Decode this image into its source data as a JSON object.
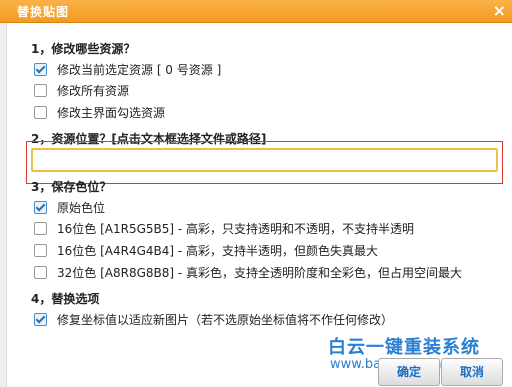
{
  "dialog": {
    "title": "替换贴图",
    "close_glyph": "×"
  },
  "section1": {
    "title": "1，修改哪些资源？",
    "options": [
      {
        "label": "修改当前选定资源 [ 0 号资源 ]",
        "checked": true
      },
      {
        "label": "修改所有资源",
        "checked": false
      },
      {
        "label": "修改主界面勾选资源",
        "checked": false
      }
    ]
  },
  "section2": {
    "title": "2，资源位置？[点击文本框选择文件或路径]",
    "path_value": ""
  },
  "section3": {
    "title": "3，保存色位？",
    "options": [
      {
        "label": "原始色位",
        "checked": true
      },
      {
        "label": "16位色 [A1R5G5B5] - 高彩，只支持透明和不透明，不支持半透明",
        "checked": false
      },
      {
        "label": "16位色 [A4R4G4B4] - 高彩，支持半透明，但颜色失真最大",
        "checked": false
      },
      {
        "label": "32位色 [A8R8G8B8] - 真彩色，支持全透明阶度和全彩色，但占用空间最大",
        "checked": false
      }
    ]
  },
  "section4": {
    "title": "4，替换选项",
    "options": [
      {
        "label": "修复坐标值以适应新图片（若不选原始坐标值将不作任何修改）",
        "checked": true
      }
    ]
  },
  "buttons": {
    "ok": "确定",
    "cancel": "取消"
  },
  "watermark": {
    "text": "白云一键重装系统",
    "url": "www.baiyunxitong.com"
  },
  "colors": {
    "title_bar": "#f7a431",
    "accent": "#1b6fc2",
    "highlight_box": "#d83a3a",
    "input_border": "#e8c24a"
  }
}
